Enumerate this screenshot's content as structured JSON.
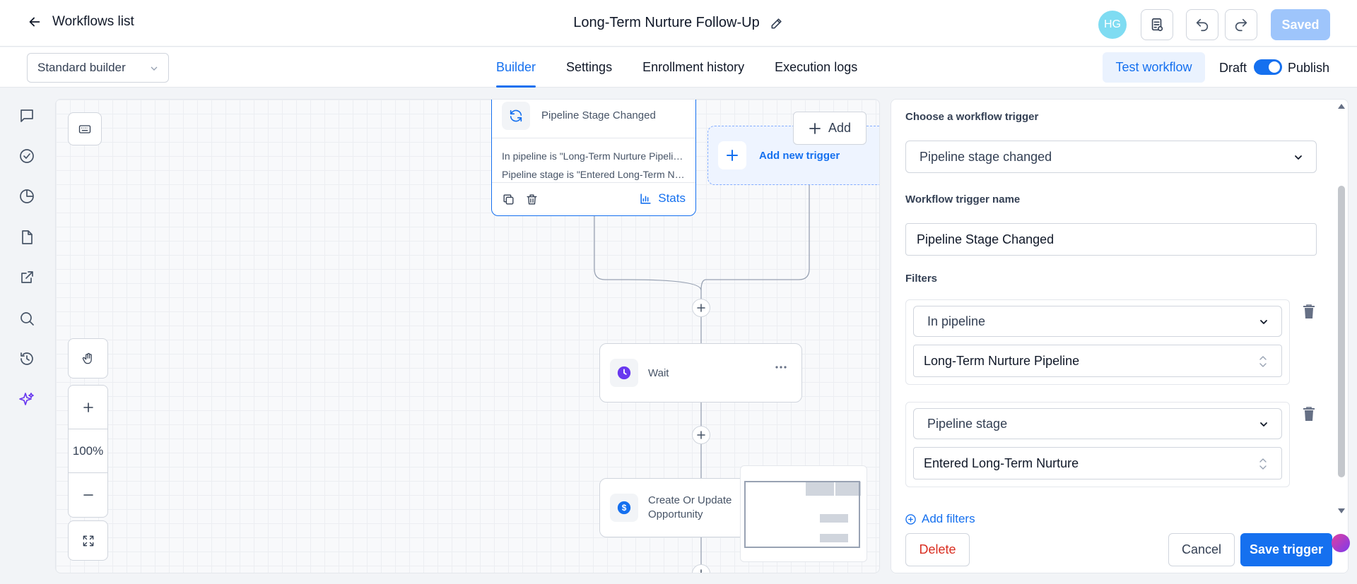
{
  "header": {
    "back_label": "Workflows list",
    "workflow_title": "Long-Term Nurture Follow-Up",
    "avatar_initials": "HG",
    "saved_label": "Saved"
  },
  "subbar": {
    "builder_select": "Standard builder",
    "tabs": [
      {
        "label": "Builder",
        "active": true
      },
      {
        "label": "Settings",
        "active": false
      },
      {
        "label": "Enrollment history",
        "active": false
      },
      {
        "label": "Execution logs",
        "active": false
      }
    ],
    "test_workflow_label": "Test workflow",
    "draft_label": "Draft",
    "publish_label": "Publish",
    "publish_toggle_on": true
  },
  "rail": {
    "icons": [
      "chat-icon",
      "check-circle-icon",
      "pie-chart-icon",
      "file-icon",
      "external-link-icon",
      "search-icon",
      "clock-history-icon",
      "sparkles-icon"
    ]
  },
  "canvas": {
    "zoom_level": "100%",
    "trigger_card": {
      "title": "Pipeline Stage Changed",
      "condition_1": "In pipeline is \"Long-Term Nurture Pipeline\"",
      "condition_2": "Pipeline stage is \"Entered Long-Term Nurture\"",
      "stats_label": "Stats"
    },
    "add_new_trigger_label": "Add new trigger",
    "add_label": "Add",
    "wait_node_label": "Wait",
    "opportunity_node_label_1": "Create Or Update",
    "opportunity_node_label_2": "Opportunity"
  },
  "panel": {
    "choose_trigger_label": "Choose a workflow trigger",
    "trigger_type_value": "Pipeline stage changed",
    "trigger_name_label": "Workflow trigger name",
    "trigger_name_value": "Pipeline Stage Changed",
    "filters_label": "Filters",
    "filters": [
      {
        "field": "In pipeline",
        "value": "Long-Term Nurture Pipeline"
      },
      {
        "field": "Pipeline stage",
        "value": "Entered Long-Term Nurture"
      }
    ],
    "add_filters_label": "Add filters",
    "delete_label": "Delete",
    "cancel_label": "Cancel",
    "save_label": "Save trigger"
  },
  "colors": {
    "accent": "#1570ef",
    "saved_button": "#9ec5fb",
    "avatar": "#7fdcf2",
    "danger": "#d92d20"
  }
}
